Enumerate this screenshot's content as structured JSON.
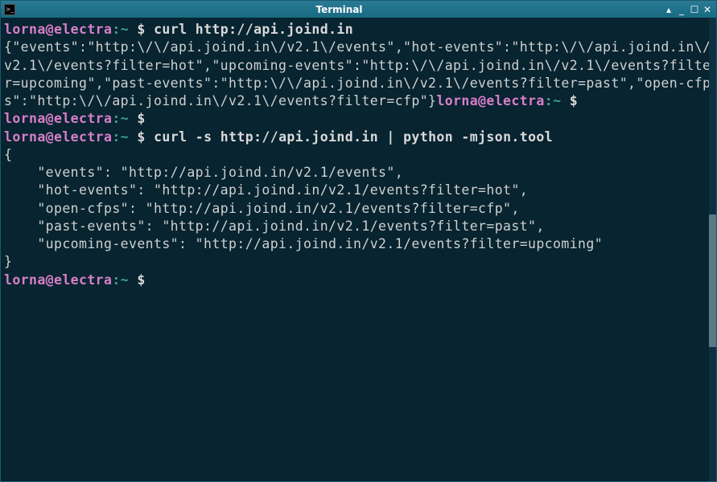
{
  "window": {
    "title": "Terminal",
    "controls": {
      "rollup": "▴",
      "minimize": "_",
      "maximize": "☐",
      "close": "✕"
    }
  },
  "prompt": {
    "user": "lorna",
    "at": "@",
    "host": "electra",
    "sep": ":",
    "path": "~",
    "symbol": " $ "
  },
  "lines": {
    "cmd1": "curl http://api.joind.in",
    "out1": "{\"events\":\"http:\\/\\/api.joind.in\\/v2.1\\/events\",\"hot-events\":\"http:\\/\\/api.joind.in\\/v2.1\\/events?filter=hot\",\"upcoming-events\":\"http:\\/\\/api.joind.in\\/v2.1\\/events?filter=upcoming\",\"past-events\":\"http:\\/\\/api.joind.in\\/v2.1\\/events?filter=past\",\"open-cfps\":\"http:\\/\\/api.joind.in\\/v2.1\\/events?filter=cfp\"}",
    "cmd2": "curl -s http://api.joind.in | python -mjson.tool",
    "out2_open": "{",
    "out2_l1": "    \"events\": \"http://api.joind.in/v2.1/events\",",
    "out2_l2": "    \"hot-events\": \"http://api.joind.in/v2.1/events?filter=hot\",",
    "out2_l3": "    \"open-cfps\": \"http://api.joind.in/v2.1/events?filter=cfp\",",
    "out2_l4": "    \"past-events\": \"http://api.joind.in/v2.1/events?filter=past\",",
    "out2_l5": "    \"upcoming-events\": \"http://api.joind.in/v2.1/events?filter=upcoming\"",
    "out2_close": "}"
  }
}
